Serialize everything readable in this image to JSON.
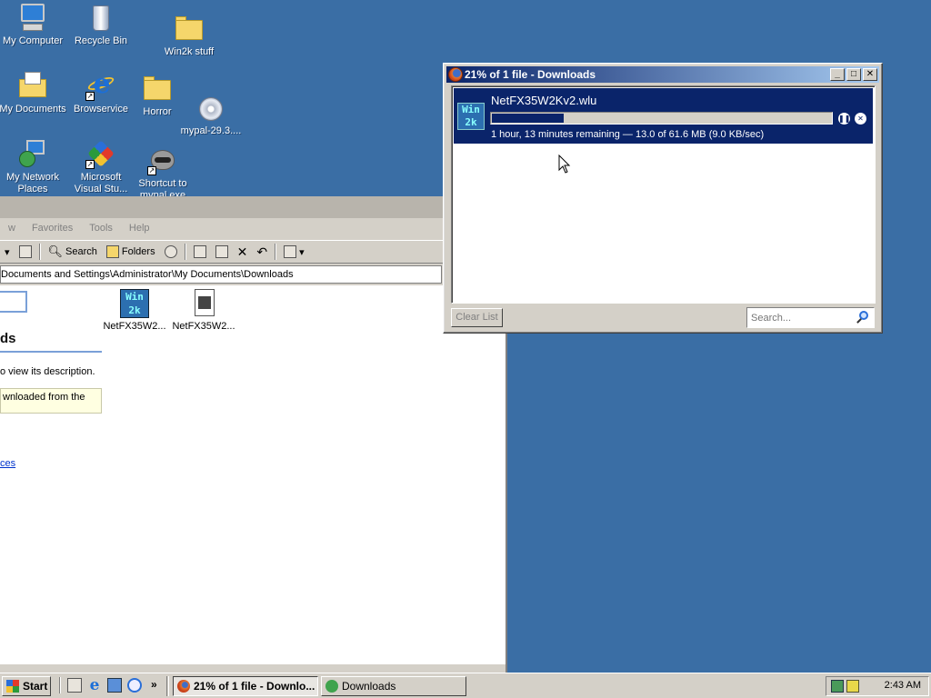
{
  "desktop": {
    "icons": [
      {
        "label": "My Computer",
        "icon": "my-computer-icon"
      },
      {
        "label": "Recycle Bin",
        "icon": "recycle-bin-icon"
      },
      {
        "label": "Win2k stuff",
        "icon": "folder-icon"
      },
      {
        "label": "My Documents",
        "icon": "my-documents-icon"
      },
      {
        "label": "Browservice",
        "icon": "internet-explorer-icon"
      },
      {
        "label": "Horror",
        "icon": "folder-icon"
      },
      {
        "label": "mypal-29.3....",
        "icon": "setup-cd-icon"
      },
      {
        "label": "My Network Places",
        "icon": "network-places-icon"
      },
      {
        "label": "Microsoft Visual Stu...",
        "icon": "visual-studio-icon"
      },
      {
        "label": "Shortcut to mypal.exe",
        "icon": "mypal-raccoon-icon"
      }
    ]
  },
  "explorer": {
    "menu": [
      "w",
      "Favorites",
      "Tools",
      "Help"
    ],
    "toolbar": {
      "search_label": "Search",
      "folders_label": "Folders"
    },
    "address": "Documents and Settings\\Administrator\\My Documents\\Downloads",
    "files": [
      {
        "label": "NetFX35W2...",
        "icon": "win2k-update-icon"
      },
      {
        "label": "NetFX35W2...",
        "icon": "setup-file-icon"
      }
    ],
    "sidebar": {
      "title": "ds",
      "description": "o view its description.",
      "info_box": "wnloaded from the",
      "link": "ces"
    }
  },
  "downloads": {
    "window_title": "21% of 1 file - Downloads",
    "item": {
      "filename": "NetFX35W2Kv2.wlu",
      "progress_percent": 21,
      "status": "1 hour, 13 minutes remaining — 13.0 of 61.6 MB (9.0 KB/sec)"
    },
    "clear_list_label": "Clear List",
    "search_placeholder": "Search...",
    "colors": {
      "selection": "#0a246a",
      "title_start": "#0a246a",
      "title_end": "#a6caf0"
    }
  },
  "taskbar": {
    "start_label": "Start",
    "more_label": "»",
    "tasks": [
      {
        "label": "21% of 1 file - Downlo...",
        "active": true
      },
      {
        "label": "Downloads",
        "active": false
      }
    ],
    "clock": "2:43 AM"
  },
  "colors": {
    "desktop": "#3a6ea5",
    "chrome": "#d4d0c8"
  }
}
